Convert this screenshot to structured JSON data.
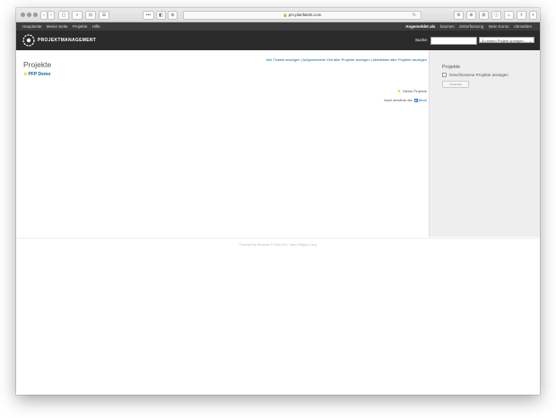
{
  "browser": {
    "url": "pm.planfabrik.com",
    "buttons": [
      "‹",
      "›",
      "▢",
      "»",
      "⊟",
      "☰",
      "•••",
      "◧",
      "⊕",
      "↻",
      "⚙",
      "⊕",
      "⊞",
      "ⓘ",
      "⌂",
      "⇪",
      "+"
    ]
  },
  "topmenu": {
    "items": [
      "Hauptseite",
      "Meine Seite",
      "Projekte",
      "Hilfe"
    ],
    "logged_in_label": "Angemeldet als",
    "user": "baumen",
    "right_items": [
      "Zeiterfassung",
      "Mein Konto",
      "Abmelden"
    ]
  },
  "header": {
    "title": "PROJEKTMANAGEMENT",
    "search_label": "Suche:",
    "jump_placeholder": "Zu einem Projekt springen..."
  },
  "main": {
    "title": "Projekte",
    "links": [
      "Alle Tickets anzeigen",
      "Aufgewendete Zeit aller Projekte anzeigen",
      "Aktivitäten aller Projekte anzeigen"
    ],
    "separator": " | ",
    "projects": [
      "PFP Demo"
    ],
    "my_projects_label": "Meine Projekte",
    "also_available": "Auch abrufbar als:",
    "atom_label": "Atom"
  },
  "sidebar": {
    "title": "Projekte",
    "checkbox_label": "Geschlossene Projekte anzeigen",
    "apply_label": "Anwenden"
  },
  "footer": {
    "text": "Powered by Redmine © 2006-2017 Jean-Philippe Lang"
  },
  "colors": {
    "link": "#116699",
    "header_bg": "#2b2b2b",
    "topmenu_bg": "#3d3d3d",
    "sidebar_bg": "#eeeeee",
    "star": "#f5c518"
  }
}
